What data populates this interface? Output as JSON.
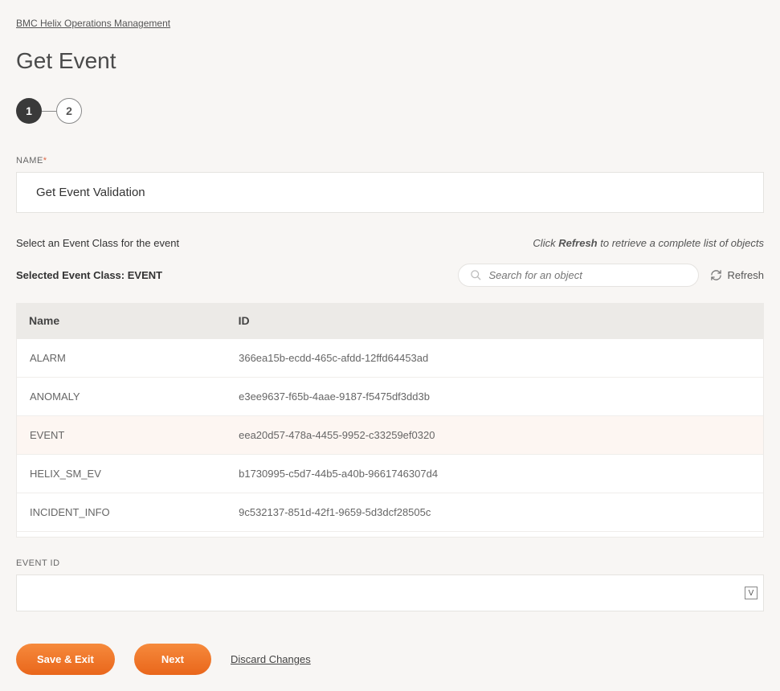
{
  "breadcrumb": "BMC Helix Operations Management",
  "page_title": "Get Event",
  "steps": [
    "1",
    "2"
  ],
  "active_step_index": 0,
  "name_field": {
    "label": "NAME",
    "required_mark": "*",
    "value": "Get Event Validation"
  },
  "select_hint": "Select an Event Class for the event",
  "refresh_hint_prefix": "Click ",
  "refresh_hint_strong": "Refresh",
  "refresh_hint_suffix": " to retrieve a complete list of objects",
  "selected_class_label": "Selected Event Class: ",
  "selected_class_value": "EVENT",
  "search_placeholder": "Search for an object",
  "refresh_label": "Refresh",
  "table": {
    "columns": [
      "Name",
      "ID"
    ],
    "rows": [
      {
        "name": "ALARM",
        "id": "366ea15b-ecdd-465c-afdd-12ffd64453ad",
        "selected": false
      },
      {
        "name": "ANOMALY",
        "id": "e3ee9637-f65b-4aae-9187-f5475df3dd3b",
        "selected": false
      },
      {
        "name": "EVENT",
        "id": "eea20d57-478a-4455-9952-c33259ef0320",
        "selected": true
      },
      {
        "name": "HELIX_SM_EV",
        "id": "b1730995-c5d7-44b5-a40b-9661746307d4",
        "selected": false
      },
      {
        "name": "INCIDENT_INFO",
        "id": "9c532137-851d-42f1-9659-5d3dcf28505c",
        "selected": false
      }
    ]
  },
  "event_id": {
    "label": "EVENT ID",
    "value": "",
    "badge": "V"
  },
  "actions": {
    "save_exit": "Save & Exit",
    "next": "Next",
    "discard": "Discard Changes"
  }
}
